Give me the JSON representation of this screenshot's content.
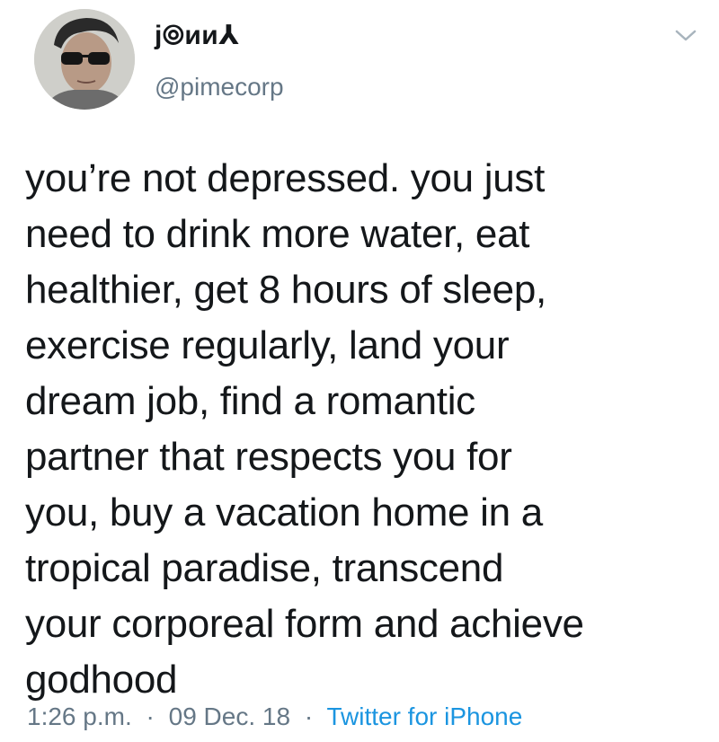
{
  "tweet": {
    "author": {
      "display_name": "j⦾ᴎᴎ⅄",
      "handle": "@pimecorp",
      "avatar_icon": "avatar-photo"
    },
    "menu_icon": "chevron-down-icon",
    "text": "you’re not depressed. you just\nneed to drink more water, eat\nhealthier, get 8 hours of sleep,\nexercise regularly, land your\ndream job, find a romantic\npartner that respects you for\nyou, buy a vacation home in a\ntropical paradise, transcend\nyour corporeal form and achieve\ngodhood",
    "time": "1:26 p.m.",
    "date": "09 Dec. 18",
    "separator": "·",
    "source": "Twitter for iPhone"
  },
  "colors": {
    "text": "#14171a",
    "secondary": "#657786",
    "link": "#1b95e0",
    "background": "#ffffff"
  }
}
